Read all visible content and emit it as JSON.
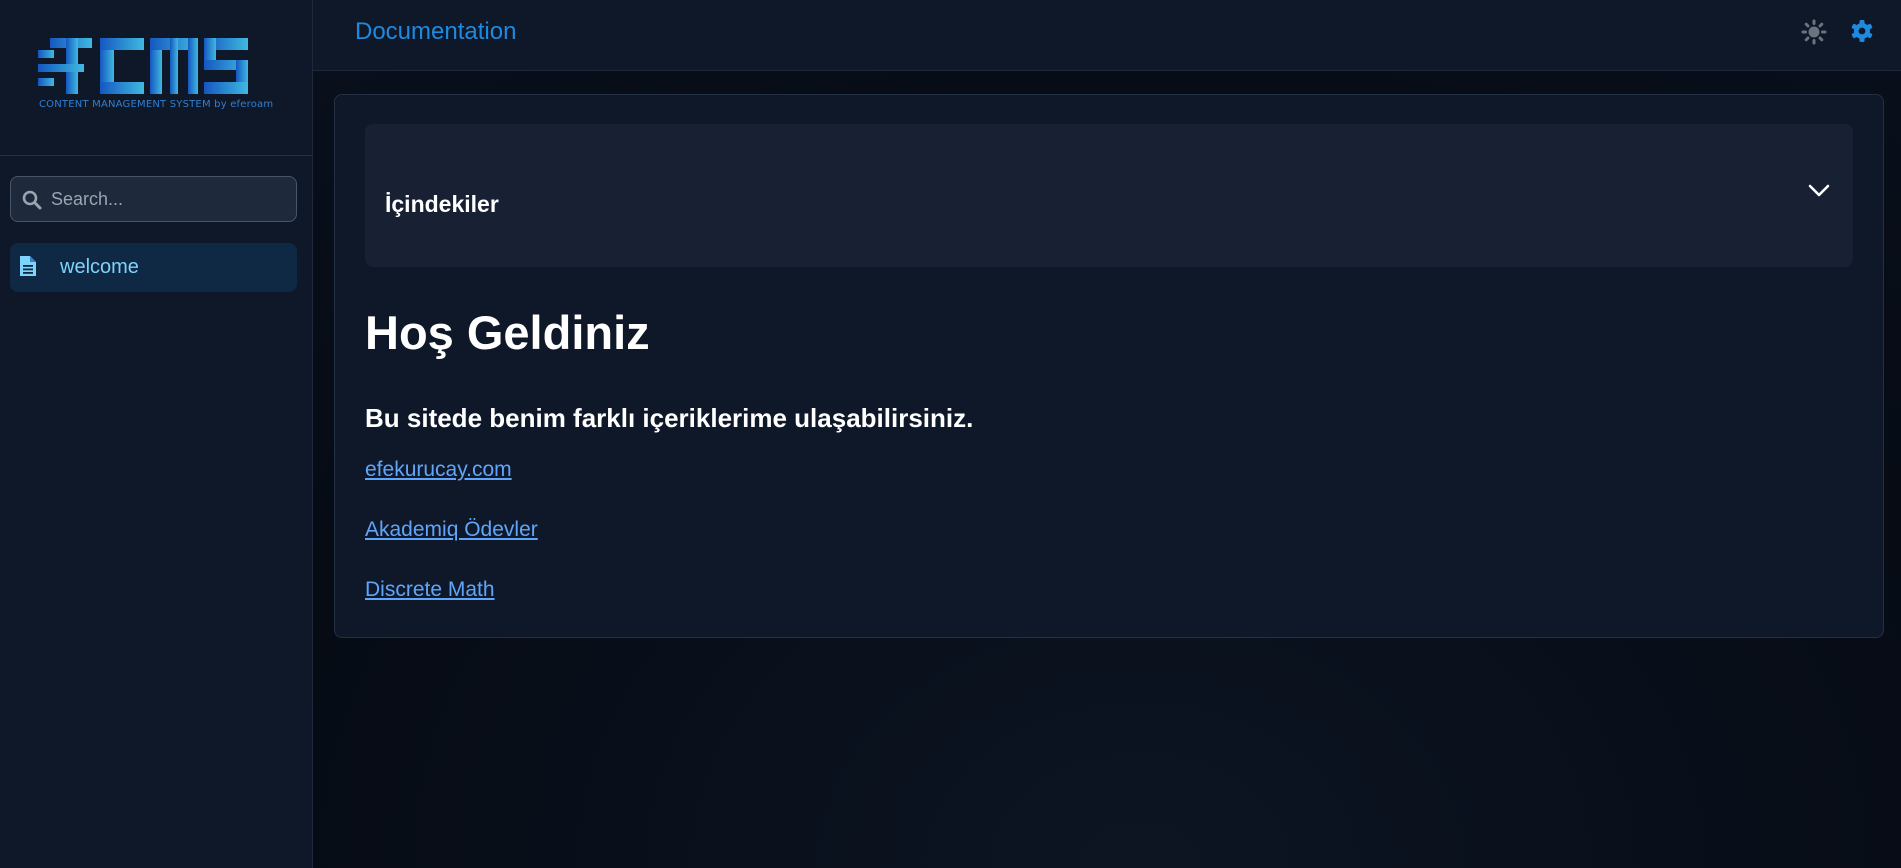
{
  "sidebar": {
    "logo": {
      "mark": "FCMS",
      "tagline": "CONTENT MANAGEMENT SYSTEM by eferoam"
    },
    "search": {
      "placeholder": "Search..."
    },
    "items": [
      {
        "label": "welcome",
        "icon": "document-icon",
        "active": true
      }
    ]
  },
  "header": {
    "title": "Documentation",
    "icons": [
      "theme-toggle-icon",
      "gear-icon"
    ]
  },
  "main": {
    "toc": {
      "label": "İçindekiler",
      "expanded": false
    },
    "heading": "Hoş Geldiniz",
    "subheading": "Bu sitede benim farklı içeriklerime ulaşabilirsiniz.",
    "links": [
      {
        "text": "efekurucay.com"
      },
      {
        "text": "Akademiq Ödevler"
      },
      {
        "text": "Discrete Math"
      }
    ]
  },
  "colors": {
    "accent": "#1d8ae0",
    "link": "#60a5fa",
    "active_nav_bg": "#0f2944",
    "active_nav_text": "#7dd3fc"
  }
}
